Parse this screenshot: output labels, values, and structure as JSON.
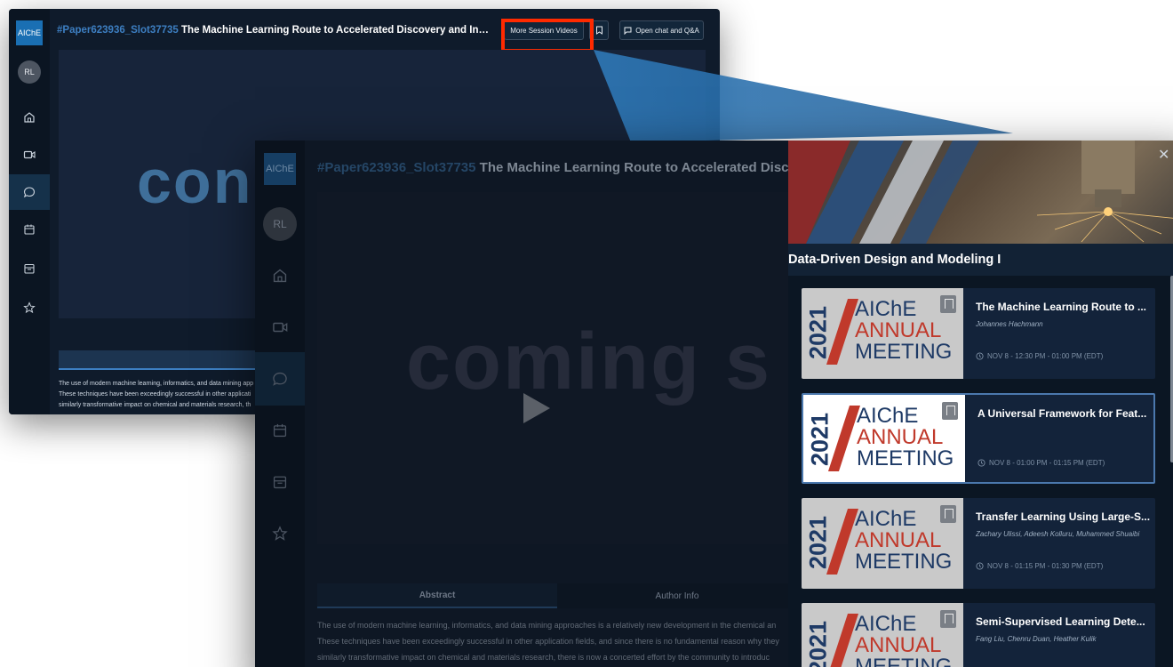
{
  "colors": {
    "accent": "#3d7fc2",
    "highlight": "#ff2a00",
    "brand_red": "#c0392b",
    "brand_navy": "#1e3a66"
  },
  "back_window": {
    "logo": "AIChE",
    "avatar": "RL",
    "title_id": "#Paper623936_Slot37735",
    "title_text": "The Machine Learning Route to Accelerated Discovery and Inverse Design of C...",
    "more_session_videos": "More Session Videos",
    "open_chat": "Open chat and Q&A",
    "video_text": "con",
    "tab_abstract": "Abstract",
    "abstract_lines": [
      "The use of modern machine learning, informatics, and data mining app",
      "These techniques have been exceedingly successful in other applicati",
      "similarly transformative impact on chemical and materials research, th"
    ],
    "nav_icons": [
      "home-icon",
      "video-icon",
      "chat-icon",
      "calendar-icon",
      "booth-icon",
      "star-icon"
    ]
  },
  "front_window": {
    "logo": "AIChE",
    "avatar": "RL",
    "title_id": "#Paper623936_Slot37735",
    "title_text": "The Machine Learning Route to Accelerated Discovery and In",
    "video_text": "coming s",
    "tab_abstract": "Abstract",
    "tab_author": "Author Info",
    "abstract_lines": [
      "The use of modern machine learning, informatics, and data mining approaches is a relatively new development in the chemical an",
      "These techniques have been exceedingly successful in other application fields, and since there is no fundamental reason why they",
      "similarly transformative impact on chemical and materials research, there is now a concerted effort by the community to introduc"
    ]
  },
  "panel": {
    "heading": "Data-Driven Design and Modeling I",
    "close": "✕",
    "thumb": {
      "year": "2021",
      "aiche": "AIChE",
      "annual": "ANNUAL",
      "meeting": "MEETING"
    },
    "items": [
      {
        "title": "The Machine Learning Route to ...",
        "authors": "Johannes Hachmann",
        "time": "NOV 8 - 12:30 PM - 01:00 PM (EDT)"
      },
      {
        "title": "A Universal Framework for Feat...",
        "authors": "",
        "time": "NOV 8 - 01:00 PM - 01:15 PM (EDT)"
      },
      {
        "title": "Transfer Learning Using Large-S...",
        "authors": "Zachary Ulissi, Adeesh Kolluru, Muhammed Shuaibi",
        "time": "NOV 8 - 01:15 PM - 01:30 PM (EDT)"
      },
      {
        "title": "Semi-Supervised Learning Dete...",
        "authors": "Fang Liu, Chenru Duan, Heather Kulik",
        "time": ""
      }
    ]
  }
}
